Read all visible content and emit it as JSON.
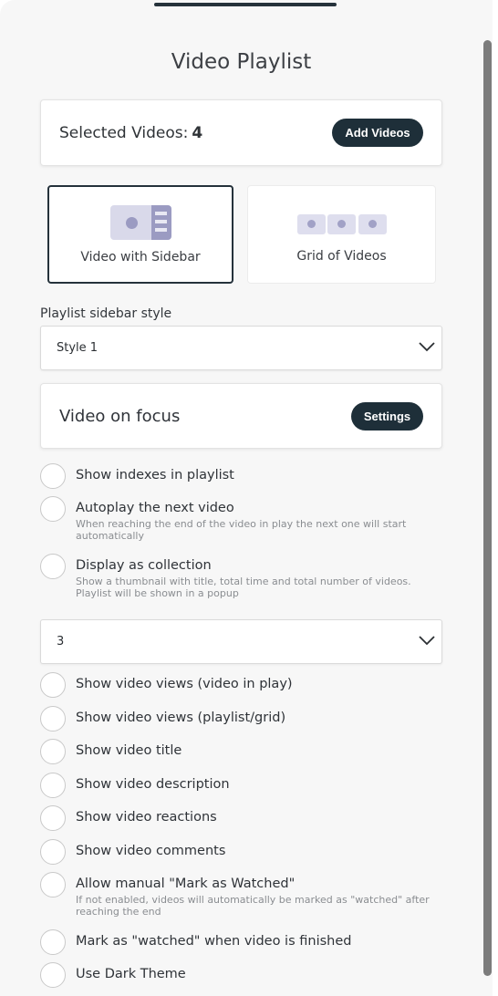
{
  "title": "Video Playlist",
  "selected": {
    "label": "Selected Videos:",
    "count": "4",
    "add_button": "Add Videos"
  },
  "layouts": [
    {
      "label": "Video with Sidebar",
      "selected": true
    },
    {
      "label": "Grid of Videos",
      "selected": false
    }
  ],
  "sidebar_style": {
    "label": "Playlist sidebar style",
    "value": "Style 1"
  },
  "focus": {
    "label": "Video on focus",
    "settings_button": "Settings"
  },
  "options_top": [
    {
      "label": "Show indexes in playlist",
      "desc": "",
      "checked": false
    },
    {
      "label": "Autoplay the next video",
      "desc": "When reaching the end of the video in play the next one will start automatically",
      "checked": false
    },
    {
      "label": "Display as collection",
      "desc": "Show a thumbnail with title, total time and total number of videos. Playlist will be shown in a popup",
      "checked": false
    }
  ],
  "count_select": {
    "value": "3"
  },
  "options_bottom": [
    {
      "label": "Show video views (video in play)",
      "desc": "",
      "checked": false
    },
    {
      "label": "Show video views (playlist/grid)",
      "desc": "",
      "checked": false
    },
    {
      "label": "Show video title",
      "desc": "",
      "checked": false
    },
    {
      "label": "Show video description",
      "desc": "",
      "checked": false
    },
    {
      "label": "Show video reactions",
      "desc": "",
      "checked": false
    },
    {
      "label": "Show video comments",
      "desc": "",
      "checked": false
    },
    {
      "label": "Allow manual \"Mark as Watched\"",
      "desc": "If not enabled, videos will automatically be marked as \"watched\" after reaching the end",
      "checked": false
    },
    {
      "label": "Mark as \"watched\" when video is finished",
      "desc": "",
      "checked": false
    },
    {
      "label": "Use Dark Theme",
      "desc": "",
      "checked": false
    }
  ],
  "colors": {
    "accent": "#1e2f39",
    "panel_bg": "#f7f7f7",
    "thumbnail_light": "#d9d9ea",
    "thumbnail_dark": "#9b9bc2"
  }
}
